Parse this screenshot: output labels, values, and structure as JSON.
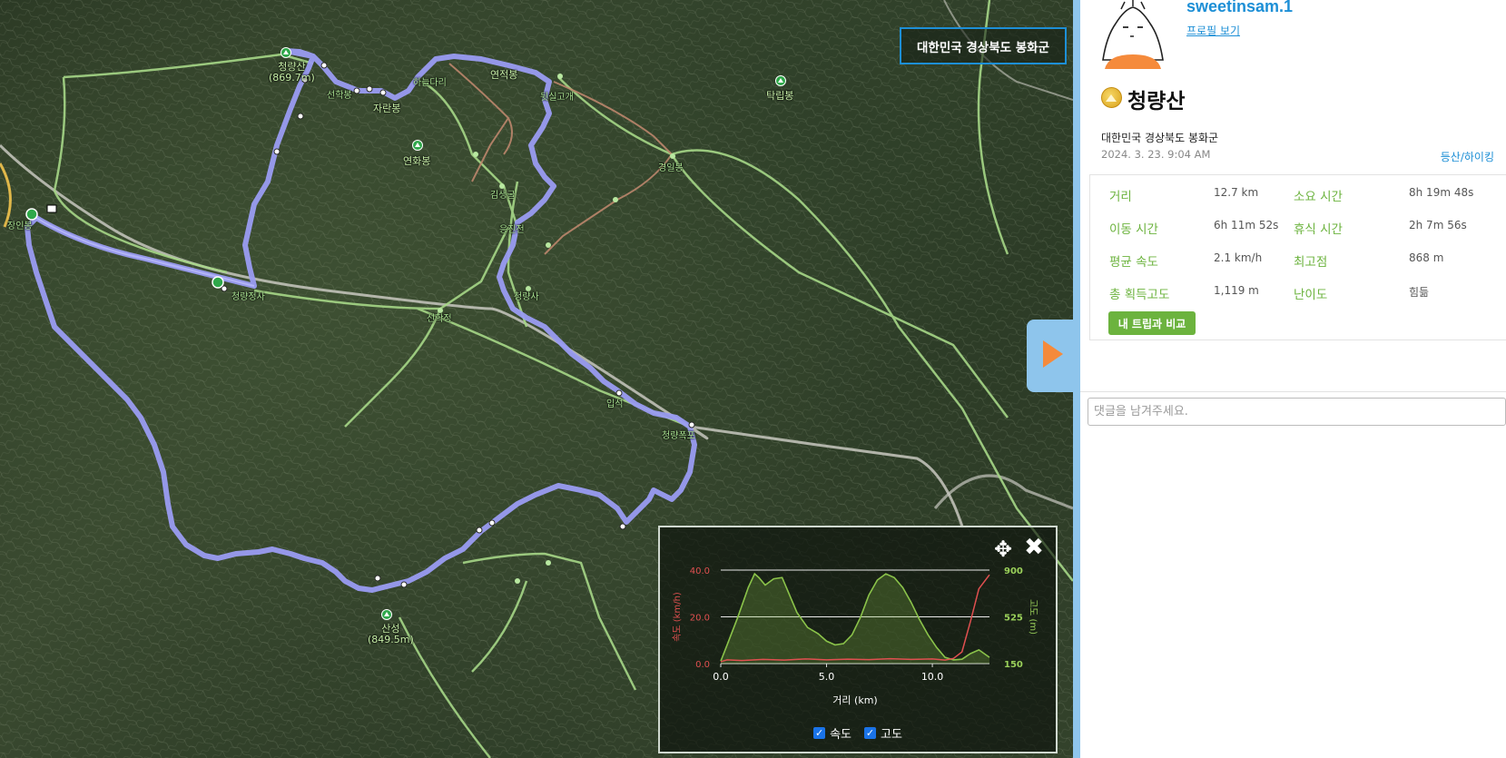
{
  "map": {
    "region": "대한민국 경상북도 봉화군",
    "labels": {
      "cheongnyangsan": "청량산",
      "cheongnyangsan_height": "(869.7m)",
      "jaranbong": "자란봉",
      "yeonjeokbong": "연적봉",
      "yeonhwabong": "연화봉",
      "takripbong": "탁립봉",
      "sanseong": "산성",
      "sanseong_height": "(849.5m)",
      "ipseok": "입석",
      "cheongnyang_pokpo": "청량폭포",
      "seonhakjeong": "선학정",
      "cheongnyangsa": "청량사",
      "small1": "선학봉",
      "small2": "하늘다리",
      "small3": "뒷실고개",
      "small4": "김생굴",
      "small5": "응진전",
      "small6": "청량정사",
      "small7": "장인봉",
      "small8": "경일봉"
    }
  },
  "chart": {
    "legend_speed": "속도",
    "legend_altitude": "고도"
  },
  "chart_data": {
    "type": "line",
    "xlabel": "거리 (km)",
    "ylabel_left": "속도 (km/h)",
    "ylabel_right": "고도 (m)",
    "x_ticks": [
      "0.0",
      "5.0",
      "10.0"
    ],
    "y_left_ticks": [
      "0.0",
      "20.0",
      "40.0"
    ],
    "y_right_ticks": [
      "150",
      "525",
      "900"
    ],
    "xlim": [
      0,
      12.7
    ],
    "ylim_left": [
      0,
      40
    ],
    "ylim_right": [
      150,
      900
    ],
    "series": [
      {
        "name": "고도",
        "color": "#8bc34a",
        "x": [
          0,
          0.3,
          0.8,
          1.3,
          1.6,
          1.8,
          2.1,
          2.5,
          2.9,
          3.2,
          3.6,
          4.1,
          4.6,
          5.0,
          5.4,
          5.8,
          6.2,
          6.6,
          7.0,
          7.4,
          7.8,
          8.2,
          8.6,
          9.0,
          9.4,
          9.8,
          10.2,
          10.6,
          11.0,
          11.4,
          11.8,
          12.2,
          12.7
        ],
        "values": [
          170,
          300,
          520,
          760,
          870,
          840,
          780,
          830,
          840,
          720,
          560,
          440,
          390,
          330,
          300,
          310,
          380,
          520,
          700,
          820,
          870,
          840,
          760,
          640,
          500,
          380,
          280,
          200,
          180,
          185,
          230,
          260,
          200
        ]
      },
      {
        "name": "속도",
        "color": "#e05050",
        "x": [
          0,
          0.3,
          1,
          2,
          3,
          4,
          5,
          6,
          7,
          8,
          9,
          10,
          10.6,
          11.0,
          11.4,
          11.8,
          12.2,
          12.7
        ],
        "values": [
          0.8,
          1.6,
          1.3,
          1.8,
          1.5,
          2.0,
          1.6,
          1.9,
          1.7,
          2.1,
          1.8,
          2.0,
          1.5,
          2.2,
          5,
          18,
          32,
          38
        ]
      }
    ]
  },
  "profile": {
    "username": "sweetinsam.1",
    "profile_link": "프로필 보기",
    "mountain": "청량산",
    "location": "대한민국 경상북도 봉화군",
    "date": "2024. 3. 23. 9:04 AM",
    "activity_type": "등산/하이킹"
  },
  "stats": [
    {
      "label": "거리",
      "value": "12.7 km"
    },
    {
      "label": "소요 시간",
      "value": "8h 19m 48s"
    },
    {
      "label": "이동 시간",
      "value": "6h 11m 52s"
    },
    {
      "label": "휴식 시간",
      "value": "2h 7m 56s"
    },
    {
      "label": "평균 속도",
      "value": "2.1 km/h"
    },
    {
      "label": "최고점",
      "value": "868 m"
    },
    {
      "label": "총 획득고도",
      "value": "1,119 m"
    },
    {
      "label": "난이도",
      "value": "힘듦"
    }
  ],
  "compare_button": "내 트립과 비교",
  "comment": {
    "placeholder": "댓글을 남겨주세요."
  },
  "colors": {
    "accent": "#1d8fd6",
    "green": "#6cb33e",
    "track": "#8b8ff0",
    "divider": "#8ec5ec"
  }
}
